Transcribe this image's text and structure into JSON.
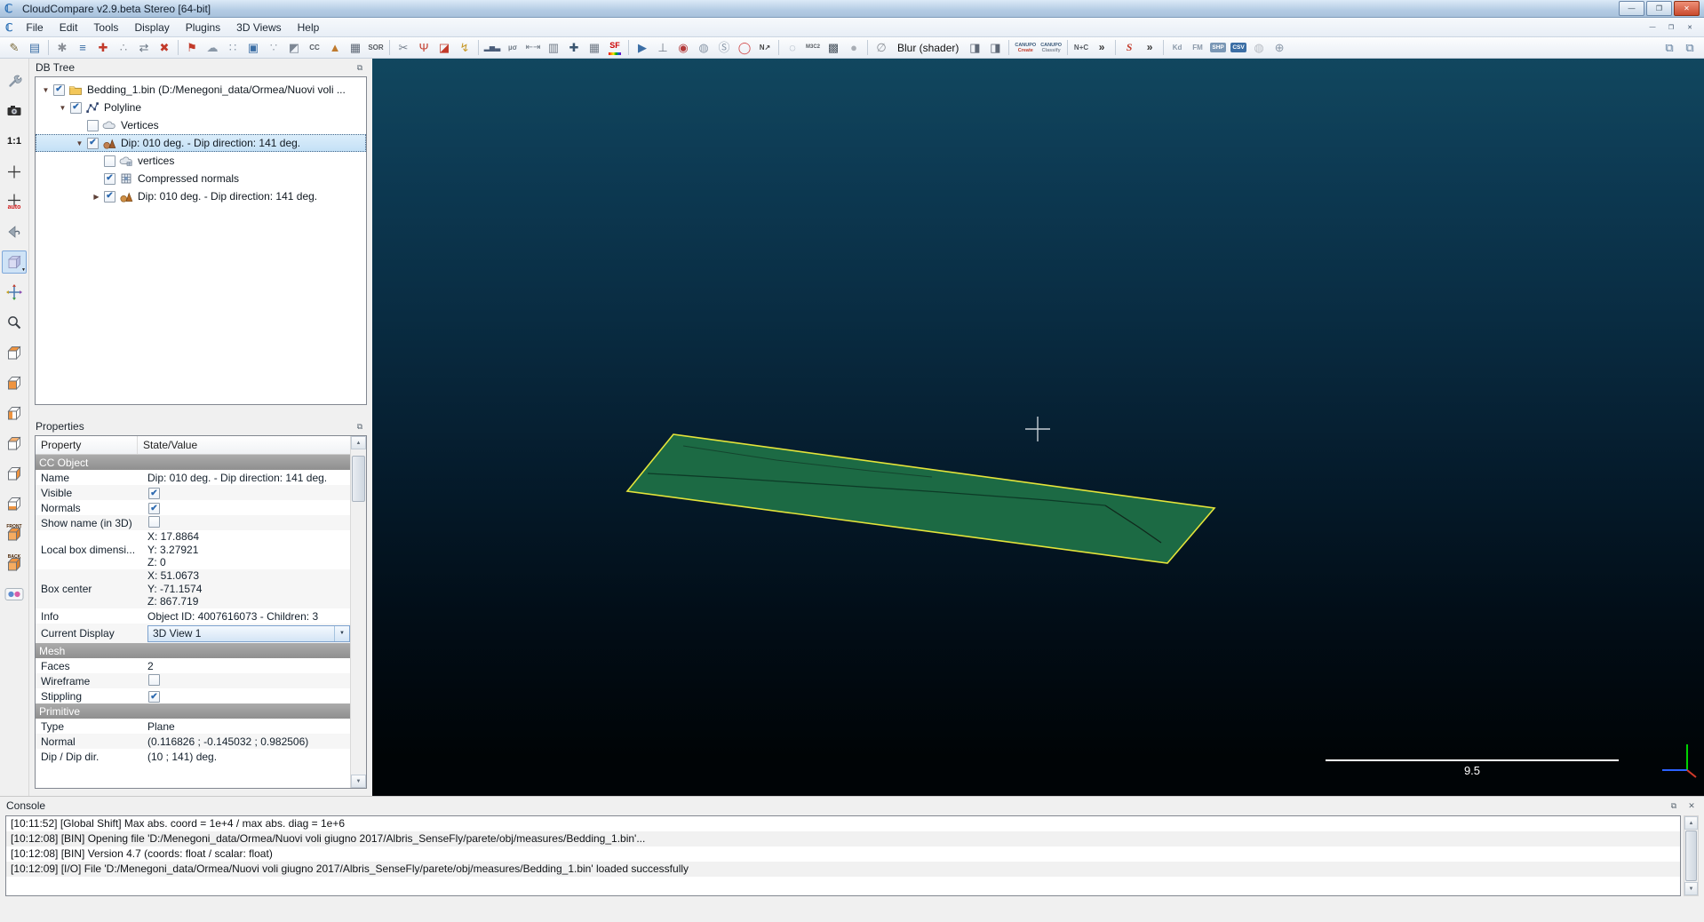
{
  "window": {
    "title": "CloudCompare v2.9.beta Stereo [64-bit]",
    "logo_glyph": "ℂ",
    "buttons": [
      {
        "name": "minimize",
        "glyph": "—"
      },
      {
        "name": "maximize",
        "glyph": "❐"
      },
      {
        "name": "close",
        "glyph": "✕"
      }
    ]
  },
  "menu": {
    "items": [
      "File",
      "Edit",
      "Tools",
      "Display",
      "Plugins",
      "3D Views",
      "Help"
    ]
  },
  "toolbar": {
    "items": [
      {
        "type": "icon",
        "name": "toolbar-open",
        "glyph": "✎",
        "color": "#7a6a3a"
      },
      {
        "type": "icon",
        "name": "toolbar-save",
        "glyph": "▤",
        "color": "#3b6ea5"
      },
      {
        "type": "sep"
      },
      {
        "type": "icon",
        "name": "toolbar-display-settings",
        "glyph": "✱",
        "color": "#8a8f96"
      },
      {
        "type": "icon",
        "name": "toolbar-properties",
        "glyph": "≡",
        "color": "#3b6ea5"
      },
      {
        "type": "icon",
        "name": "toolbar-apply-transformation",
        "glyph": "✚",
        "color": "#c23a2a"
      },
      {
        "type": "icon",
        "name": "toolbar-pick-points",
        "glyph": "∴",
        "color": "#8a8f96"
      },
      {
        "type": "icon",
        "name": "toolbar-clone",
        "glyph": "⇄",
        "color": "#6a7684"
      },
      {
        "type": "icon",
        "name": "toolbar-delete",
        "glyph": "✖",
        "color": "#c23a2a"
      },
      {
        "type": "sep"
      },
      {
        "type": "icon",
        "name": "toolbar-point-picking",
        "glyph": "⚑",
        "color": "#c23a2a"
      },
      {
        "type": "icon",
        "name": "toolbar-cloud-sampling",
        "glyph": "☁",
        "color": "#8a98a8"
      },
      {
        "type": "icon",
        "name": "toolbar-point-list-picking",
        "glyph": "∷",
        "color": "#8a98a8"
      },
      {
        "type": "icon",
        "name": "toolbar-clipping-box",
        "glyph": "▣",
        "color": "#3b6ea5"
      },
      {
        "type": "icon",
        "name": "toolbar-subsample",
        "glyph": "∵",
        "color": "#9aa2ac"
      },
      {
        "type": "icon",
        "name": "toolbar-interpolate",
        "glyph": "◩",
        "color": "#7d8794"
      },
      {
        "type": "text",
        "name": "toolbar-c2c-distance",
        "glyph": "CC",
        "color": "#555a60"
      },
      {
        "type": "icon",
        "name": "toolbar-mesh-delaunay",
        "glyph": "▲",
        "color": "#bf7a2e"
      },
      {
        "type": "icon",
        "name": "toolbar-rasterize",
        "glyph": "▦",
        "color": "#5e6876"
      },
      {
        "type": "text",
        "name": "toolbar-sor-filter",
        "glyph": "SOR",
        "color": "#555a60"
      },
      {
        "type": "sep"
      },
      {
        "type": "icon",
        "name": "toolbar-cross-section",
        "glyph": "✂",
        "color": "#77818e"
      },
      {
        "type": "icon",
        "name": "toolbar-level",
        "glyph": "Ψ",
        "color": "#c23a2a"
      },
      {
        "type": "icon",
        "name": "toolbar-unroll",
        "glyph": "◪",
        "color": "#c23a2a"
      },
      {
        "type": "icon",
        "name": "toolbar-fast-registration",
        "glyph": "↯",
        "color": "#c79a2a"
      },
      {
        "type": "sep"
      },
      {
        "type": "icon",
        "name": "toolbar-histogram",
        "glyph": "▂▅▃",
        "color": "#4a5d7a",
        "size": 8
      },
      {
        "type": "text",
        "name": "toolbar-gaussian-filter",
        "glyph": "µσ",
        "color": "#707a86"
      },
      {
        "type": "icon",
        "name": "toolbar-sf-minmax",
        "glyph": "⇤⇥",
        "color": "#707a86",
        "size": 10
      },
      {
        "type": "icon",
        "name": "toolbar-filter-by-value",
        "glyph": "▥",
        "color": "#707a86"
      },
      {
        "type": "icon",
        "name": "toolbar-sf-add",
        "glyph": "✚",
        "color": "#3a5570"
      },
      {
        "type": "icon",
        "name": "toolbar-sf-calculator",
        "glyph": "▦",
        "color": "#707a86"
      },
      {
        "type": "sf",
        "name": "toolbar-sf-colors",
        "glyph": "SF",
        "color": "#cc0000",
        "size": 9
      },
      {
        "type": "sep"
      },
      {
        "type": "icon",
        "name": "toolbar-animation",
        "glyph": "▶",
        "color": "#3b6ea5"
      },
      {
        "type": "icon",
        "name": "toolbar-plumb",
        "glyph": "⊥",
        "color": "#707a86"
      },
      {
        "type": "icon",
        "name": "toolbar-compass",
        "glyph": "◉",
        "color": "#b23a3a"
      },
      {
        "type": "icon",
        "name": "toolbar-facets",
        "glyph": "◍",
        "color": "#8a98a8"
      },
      {
        "type": "icon",
        "name": "toolbar-sf-projection",
        "glyph": "Ⓢ",
        "color": "#8a98a8"
      },
      {
        "type": "icon",
        "name": "toolbar-fit-ellipse",
        "glyph": "◯",
        "color": "#d24a4a"
      },
      {
        "type": "text",
        "name": "toolbar-north-arrow",
        "glyph": "N↗",
        "color": "#444"
      },
      {
        "type": "sep"
      },
      {
        "type": "icon",
        "name": "toolbar-hpr",
        "glyph": "◌",
        "color": "#8a98a8"
      },
      {
        "type": "text",
        "name": "toolbar-m3c2",
        "glyph": "M3C2",
        "color": "#555a60",
        "size": 6
      },
      {
        "type": "icon",
        "name": "toolbar-rgb-filter",
        "glyph": "▩",
        "color": "#4a5560"
      },
      {
        "type": "icon",
        "name": "toolbar-pcv",
        "glyph": "●",
        "color": "#a8adb4"
      },
      {
        "type": "sep"
      },
      {
        "type": "icon",
        "name": "toolbar-shader-off",
        "glyph": "∅",
        "color": "#8a8f96"
      },
      {
        "type": "label",
        "name": "toolbar-shader-label",
        "label": "Blur (shader)"
      },
      {
        "type": "icon",
        "name": "toolbar-render-effect-1",
        "glyph": "◨",
        "color": "#5e6876"
      },
      {
        "type": "icon",
        "name": "toolbar-render-effect-2",
        "glyph": "◨",
        "color": "#5e6876"
      },
      {
        "type": "sep"
      },
      {
        "type": "stack",
        "name": "toolbar-canupo-create",
        "lines": [
          "CANUPO",
          "Create"
        ],
        "color": "#c23a2a"
      },
      {
        "type": "stack",
        "name": "toolbar-canupo-classify",
        "lines": [
          "CANUPO",
          "Classify"
        ],
        "color": "#7d8794"
      },
      {
        "type": "sep"
      },
      {
        "type": "text",
        "name": "toolbar-npc",
        "glyph": "N+C",
        "color": "#555a60"
      },
      {
        "type": "text",
        "name": "toolbar-overflow-1",
        "glyph": "»",
        "color": "#333",
        "size": 12
      },
      {
        "type": "sep"
      },
      {
        "type": "text",
        "name": "toolbar-polyline-tracer",
        "glyph": "S",
        "color": "#c23a2a",
        "italic": true,
        "size": 12
      },
      {
        "type": "text",
        "name": "toolbar-overflow-2",
        "glyph": "»",
        "color": "#333",
        "size": 12
      },
      {
        "type": "sep"
      },
      {
        "type": "text",
        "name": "toolbar-kd-tree",
        "glyph": "Kd",
        "color": "#8a98a8"
      },
      {
        "type": "text",
        "name": "toolbar-fm",
        "glyph": "FM",
        "color": "#8a98a8"
      },
      {
        "type": "badge",
        "name": "toolbar-shp-export",
        "glyph": "SHP",
        "bg": "#7a97b5"
      },
      {
        "type": "badge",
        "name": "toolbar-csv-export",
        "glyph": "CSV",
        "bg": "#3b6ea5"
      },
      {
        "type": "icon",
        "name": "toolbar-sphere",
        "glyph": "◍",
        "color": "#b8bdc4"
      },
      {
        "type": "icon",
        "name": "toolbar-globe",
        "glyph": "⊕",
        "color": "#8a98a8"
      },
      {
        "type": "spacer"
      },
      {
        "type": "icon",
        "name": "toolbar-dock-1",
        "glyph": "⧉",
        "color": "#5a7a9a"
      },
      {
        "type": "icon",
        "name": "toolbar-dock-2",
        "glyph": "⧉",
        "color": "#5a7a9a"
      }
    ]
  },
  "left_toolbar": {
    "items": [
      {
        "name": "display-options",
        "kind": "wrench"
      },
      {
        "name": "screenshot",
        "kind": "camera"
      },
      {
        "name": "zoom-1-1",
        "kind": "text",
        "label": "1:1"
      },
      {
        "name": "set-pivot",
        "kind": "cross",
        "sub": ""
      },
      {
        "name": "set-pivot-auto",
        "kind": "cross",
        "sub": "auto"
      },
      {
        "name": "default-view",
        "kind": "backview"
      },
      {
        "name": "global-zoom",
        "kind": "bluecube",
        "selected": true
      },
      {
        "name": "pivot-rotation-mode",
        "kind": "pan"
      },
      {
        "name": "zoom-on-selection",
        "kind": "magnifier"
      },
      {
        "name": "view-top",
        "kind": "cube",
        "face": "top"
      },
      {
        "name": "view-front",
        "kind": "cube",
        "face": "front"
      },
      {
        "name": "view-left",
        "kind": "cube",
        "face": "left"
      },
      {
        "name": "view-back",
        "kind": "cube",
        "face": "back"
      },
      {
        "name": "view-right",
        "kind": "cube",
        "face": "right"
      },
      {
        "name": "view-bottom",
        "kind": "cube",
        "face": "bottom"
      },
      {
        "name": "view-iso-front",
        "kind": "cubelabel",
        "label": "FRONT"
      },
      {
        "name": "view-iso-back",
        "kind": "cubelabel",
        "label": "BACK"
      },
      {
        "name": "stereo-glasses",
        "kind": "dots"
      }
    ]
  },
  "db_tree": {
    "title": "DB Tree",
    "float_glyph": "⧉",
    "items": [
      {
        "depth": 0,
        "arrow": "down",
        "checked": true,
        "icon": "folder",
        "label": "Bedding_1.bin (D:/Menegoni_data/Ormea/Nuovi voli ...",
        "selected": false
      },
      {
        "depth": 1,
        "arrow": "down",
        "checked": true,
        "icon": "polyline",
        "label": "Polyline",
        "selected": false
      },
      {
        "depth": 2,
        "arrow": null,
        "checked": false,
        "icon": "cloud",
        "label": "Vertices",
        "selected": false
      },
      {
        "depth": 2,
        "arrow": "down",
        "checked": true,
        "icon": "plane",
        "label": "Dip: 010 deg. - Dip direction: 141 deg.",
        "selected": true
      },
      {
        "depth": 3,
        "arrow": null,
        "checked": false,
        "icon": "cloudsf",
        "label": "vertices",
        "selected": false
      },
      {
        "depth": 3,
        "arrow": null,
        "checked": true,
        "icon": "normals",
        "label": "Compressed normals",
        "selected": false
      },
      {
        "depth": 3,
        "arrow": "right",
        "checked": true,
        "icon": "plane2",
        "label": "Dip: 010 deg. - Dip direction: 141 deg.",
        "selected": false
      }
    ]
  },
  "properties": {
    "title": "Properties",
    "float_glyph": "⧉",
    "header": {
      "property": "Property",
      "value": "State/Value"
    },
    "rows": [
      {
        "type": "section",
        "label": "CC Object"
      },
      {
        "type": "text",
        "label": "Name",
        "value": "Dip: 010 deg. - Dip direction: 141 deg."
      },
      {
        "type": "checkbox",
        "label": "Visible",
        "checked": true
      },
      {
        "type": "checkbox",
        "label": "Normals",
        "checked": true
      },
      {
        "type": "checkbox",
        "label": "Show name (in 3D)",
        "checked": false
      },
      {
        "type": "multi",
        "label": "Local box dimensi...",
        "lines": [
          "X: 17.8864",
          "Y: 3.27921",
          "Z: 0"
        ]
      },
      {
        "type": "multi",
        "label": "Box center",
        "lines": [
          "X: 51.0673",
          "Y: -71.1574",
          "Z: 867.719"
        ]
      },
      {
        "type": "text",
        "label": "Info",
        "value": "Object ID: 4007616073 - Children: 3"
      },
      {
        "type": "combo",
        "label": "Current Display",
        "value": "3D View 1"
      },
      {
        "type": "section",
        "label": "Mesh"
      },
      {
        "type": "text",
        "label": "Faces",
        "value": "2"
      },
      {
        "type": "checkbox",
        "label": "Wireframe",
        "checked": false
      },
      {
        "type": "checkbox",
        "label": "Stippling",
        "checked": true
      },
      {
        "type": "section",
        "label": "Primitive"
      },
      {
        "type": "text",
        "label": "Type",
        "value": "Plane"
      },
      {
        "type": "text",
        "label": "Normal",
        "value": "(0.116826 ; -0.145032 ; 0.982506)"
      },
      {
        "type": "text",
        "label": "Dip / Dip dir.",
        "value": "(10 ; 141) deg."
      }
    ]
  },
  "viewport": {
    "scale_label": "9.5",
    "plane_color": "#1c6a44",
    "plane_outline": "#e4e43a",
    "crosshair_color": "#c5ced4",
    "background_top": "#11475f",
    "background_bottom": "#000406"
  },
  "console": {
    "title": "Console",
    "icons": {
      "float_glyph": "⧉",
      "close_glyph": "✕"
    },
    "lines": [
      "[10:11:52] [Global Shift] Max abs. coord = 1e+4 / max abs. diag = 1e+6",
      "[10:12:08] [BIN] Opening file 'D:/Menegoni_data/Ormea/Nuovi voli giugno 2017/Albris_SenseFly/parete/obj/measures/Bedding_1.bin'...",
      "[10:12:08] [BIN] Version 4.7 (coords: float / scalar: float)",
      "[10:12:09] [I/O] File 'D:/Menegoni_data/Ormea/Nuovi voli giugno 2017/Albris_SenseFly/parete/obj/measures/Bedding_1.bin' loaded successfully"
    ]
  }
}
